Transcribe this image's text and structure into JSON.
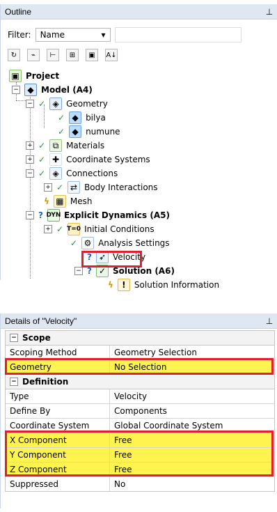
{
  "outline": {
    "title": "Outline",
    "pin_icon": "pin-icon",
    "filter": {
      "label": "Filter:",
      "select_value": "Name"
    },
    "toolbar": [
      "refresh-icon",
      "filter-icon",
      "tree-icon",
      "expand-icon",
      "folder-icon",
      "sort-icon"
    ],
    "tree": [
      {
        "name": "Project",
        "bold": true
      },
      {
        "name": "Model (A4)",
        "bold": true
      },
      {
        "name": "Geometry"
      },
      {
        "name": "bilya"
      },
      {
        "name": "numune"
      },
      {
        "name": "Materials"
      },
      {
        "name": "Coordinate Systems"
      },
      {
        "name": "Connections"
      },
      {
        "name": "Body Interactions"
      },
      {
        "name": "Mesh"
      },
      {
        "name": "Explicit Dynamics (A5)",
        "bold": true
      },
      {
        "name": "Initial Conditions"
      },
      {
        "name": "Analysis Settings"
      },
      {
        "name": "Velocity"
      },
      {
        "name": "Solution (A6)",
        "bold": true
      },
      {
        "name": "Solution Information"
      }
    ]
  },
  "details": {
    "title": "Details of \"Velocity\"",
    "pin_icon": "pin-icon",
    "sections": [
      {
        "name": "Scope",
        "rows": [
          {
            "label": "Scoping Method",
            "value": "Geometry Selection"
          },
          {
            "label": "Geometry",
            "value": "No Selection",
            "highlight": true
          }
        ]
      },
      {
        "name": "Definition",
        "rows": [
          {
            "label": "Type",
            "value": "Velocity"
          },
          {
            "label": "Define By",
            "value": "Components"
          },
          {
            "label": "Coordinate System",
            "value": "Global Coordinate System"
          },
          {
            "label": "X Component",
            "value": "Free",
            "highlight": true
          },
          {
            "label": "Y Component",
            "value": "Free",
            "highlight": true
          },
          {
            "label": "Z Component",
            "value": "Free",
            "highlight": true
          },
          {
            "label": "Suppressed",
            "value": "No"
          }
        ]
      }
    ]
  },
  "colors": {
    "accent_red": "#e0202c",
    "highlight_yellow": "#fff34f",
    "panel_header": "#dfe7f3",
    "check_green": "#1e9d3a",
    "question_blue": "#1e63c9"
  }
}
